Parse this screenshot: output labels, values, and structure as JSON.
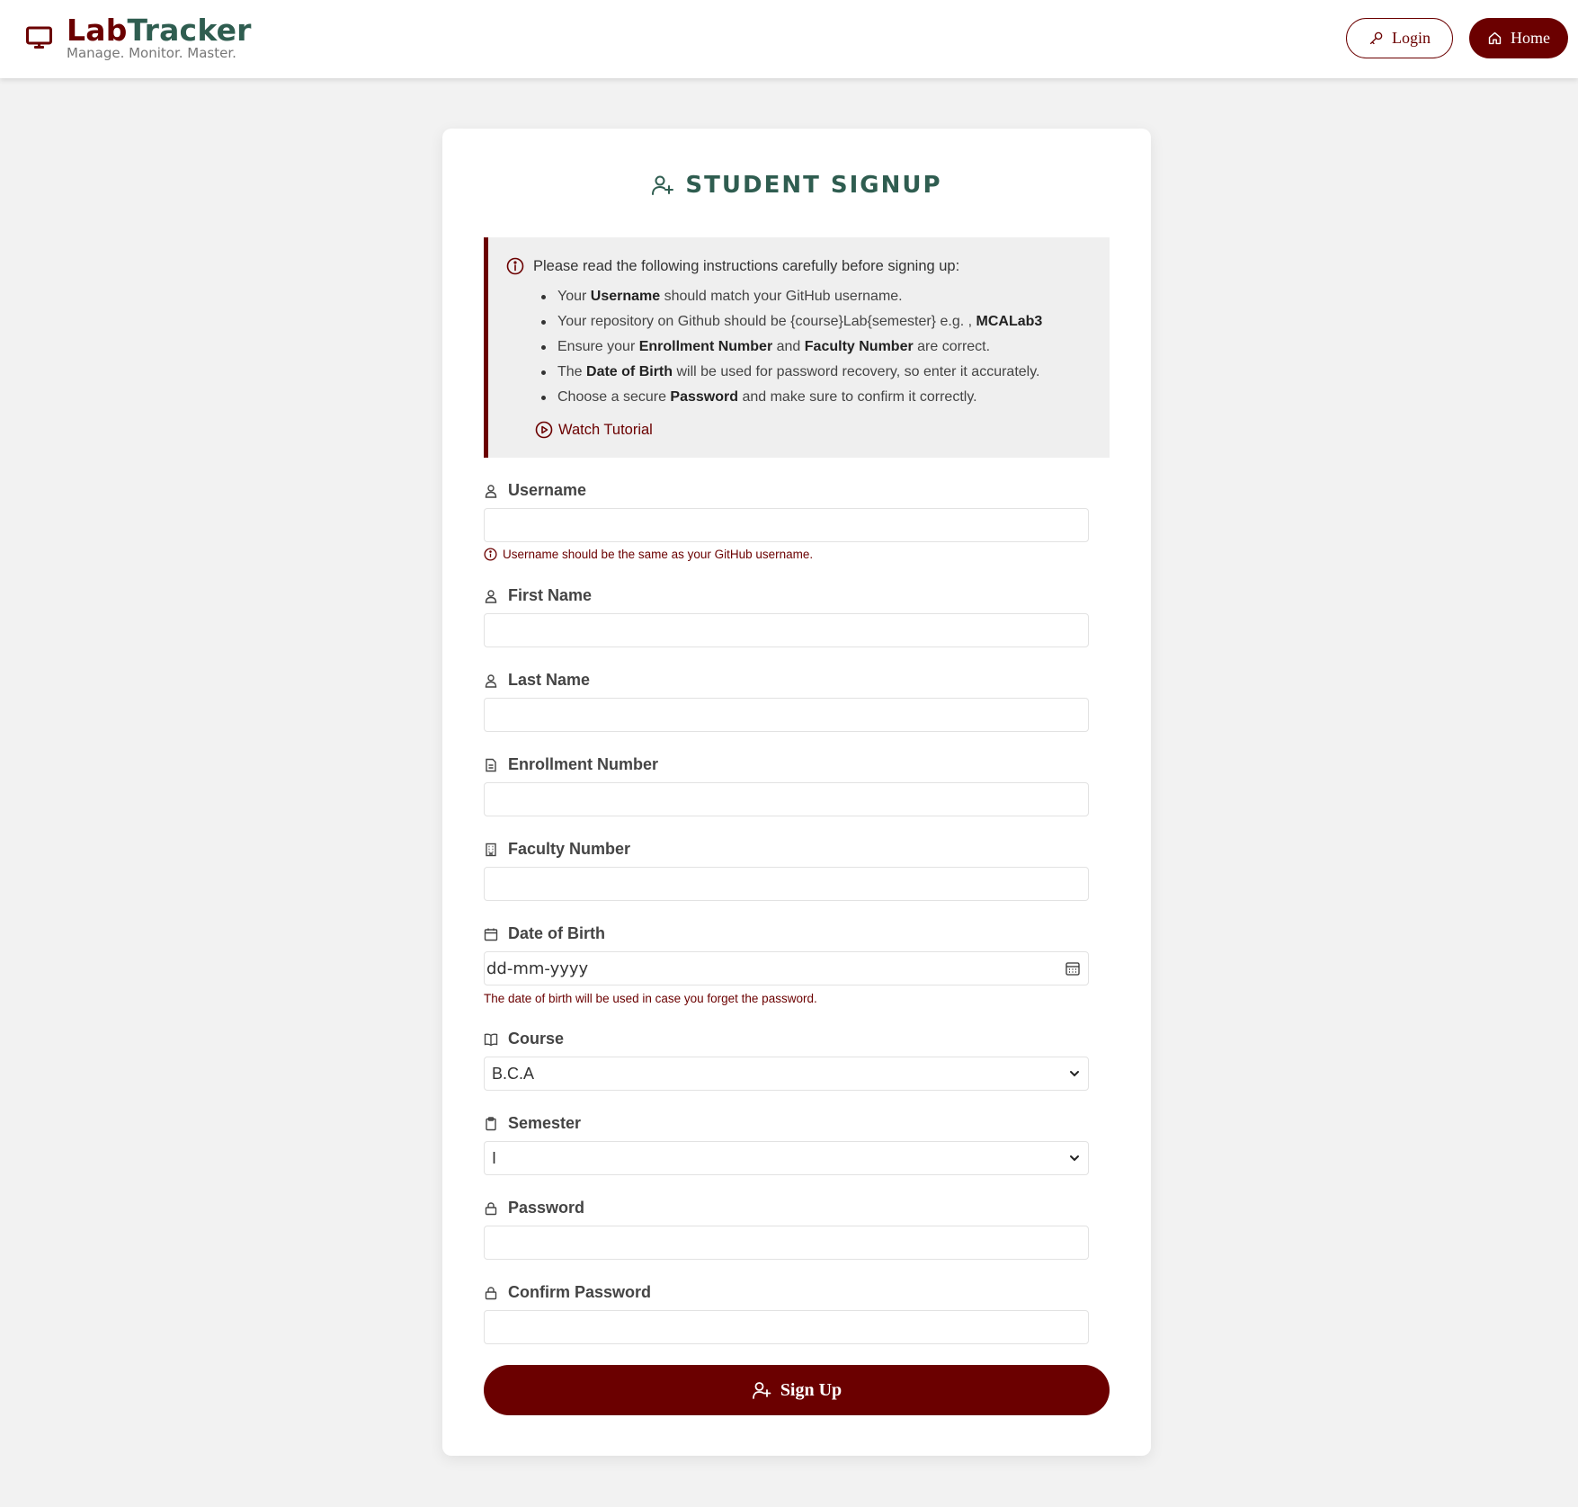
{
  "header": {
    "brand_lab": "Lab",
    "brand_tracker": "Tracker",
    "tagline": "Manage. Monitor. Master.",
    "login_label": "Login",
    "home_label": "Home"
  },
  "colors": {
    "primary": "#6b0000",
    "secondary": "#2f5d50",
    "background": "#f2f2f2"
  },
  "form": {
    "title": "STUDENT SIGNUP",
    "instructions": {
      "heading": "Please read the following instructions carefully before signing up:",
      "items": [
        {
          "pre": "Your ",
          "b1": "Username",
          "mid": " should match your GitHub username.",
          "b2": "",
          "post": ""
        },
        {
          "pre": "Your repository on Github should be {course}Lab{semester} e.g. , ",
          "b1": "MCALab3",
          "mid": "",
          "b2": "",
          "post": ""
        },
        {
          "pre": "Ensure your ",
          "b1": "Enrollment Number",
          "mid": " and ",
          "b2": "Faculty Number",
          "post": " are correct."
        },
        {
          "pre": "The ",
          "b1": "Date of Birth",
          "mid": " will be used for password recovery, so enter it accurately.",
          "b2": "",
          "post": ""
        },
        {
          "pre": "Choose a secure ",
          "b1": "Password",
          "mid": " and make sure to confirm it correctly.",
          "b2": "",
          "post": ""
        }
      ],
      "tutorial_label": "Watch Tutorial"
    },
    "fields": {
      "username": {
        "label": "Username",
        "value": "",
        "hint": "Username should be the same as your GitHub username."
      },
      "first_name": {
        "label": "First Name",
        "value": ""
      },
      "last_name": {
        "label": "Last Name",
        "value": ""
      },
      "enrollment": {
        "label": "Enrollment Number",
        "value": ""
      },
      "faculty": {
        "label": "Faculty Number",
        "value": ""
      },
      "dob": {
        "label": "Date of Birth",
        "placeholder": "dd-mm-yyyy",
        "hint": "The date of birth will be used in case you forget the password."
      },
      "course": {
        "label": "Course",
        "selected": "B.C.A"
      },
      "semester": {
        "label": "Semester",
        "selected": "I"
      },
      "password": {
        "label": "Password",
        "value": ""
      },
      "confirm_password": {
        "label": "Confirm Password",
        "value": ""
      }
    },
    "submit_label": "Sign Up"
  }
}
